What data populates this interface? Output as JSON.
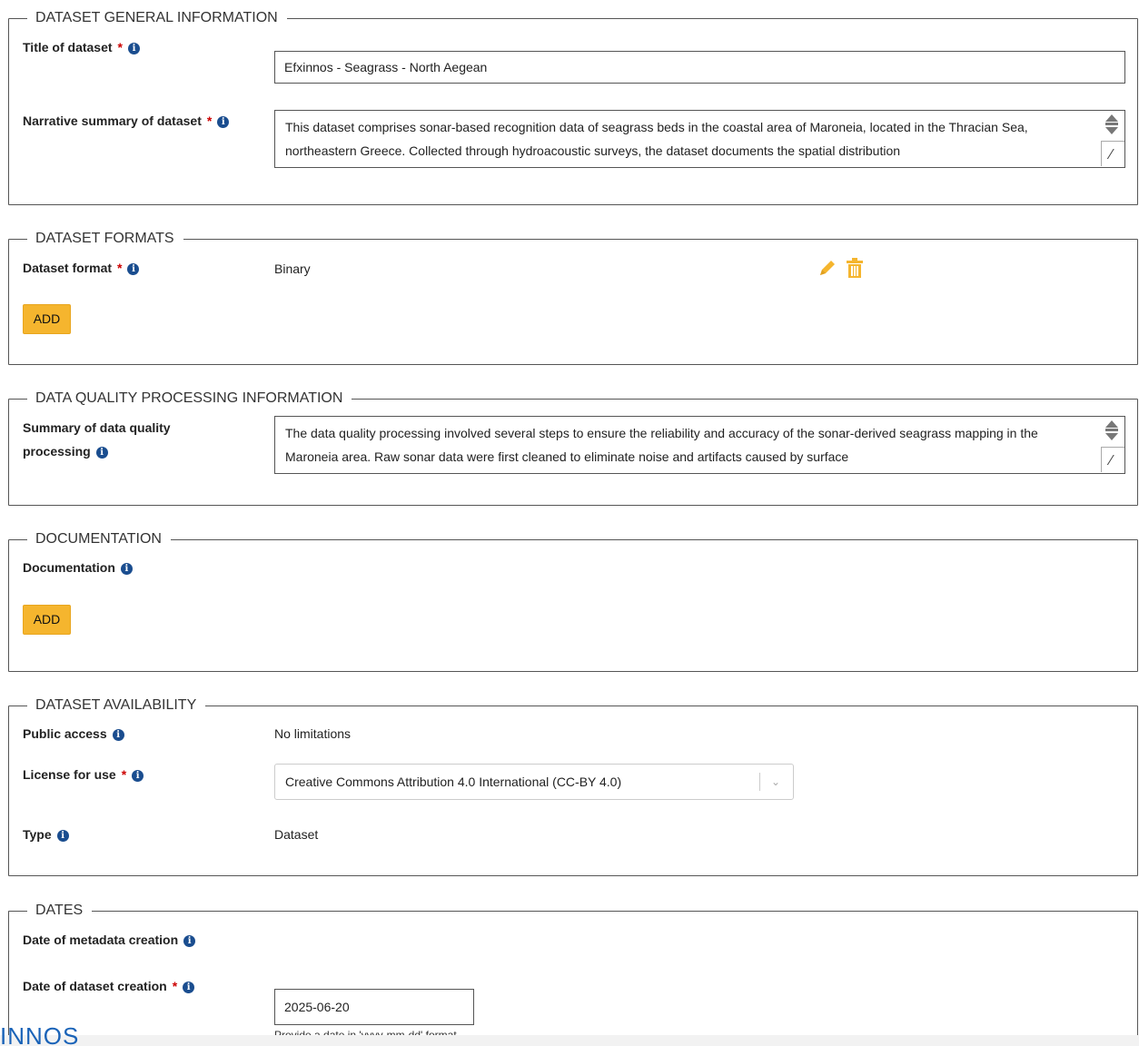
{
  "sections": {
    "general": {
      "legend": "DATASET GENERAL INFORMATION",
      "title_label": "Title of dataset",
      "title_value": "Efxinnos - Seagrass - North Aegean",
      "summary_label": "Narrative summary of dataset",
      "summary_value": "This dataset comprises sonar-based recognition data of seagrass beds in the coastal area of Maroneia, located in the Thracian Sea, northeastern Greece. Collected through hydroacoustic surveys, the dataset documents the spatial distribution"
    },
    "formats": {
      "legend": "DATASET FORMATS",
      "format_label": "Dataset format",
      "format_value": "Binary",
      "add_label": "ADD"
    },
    "quality": {
      "legend": "DATA QUALITY PROCESSING INFORMATION",
      "summary_label_line1": "Summary of data quality",
      "summary_label_line2": "processing",
      "summary_value": "The data quality processing involved several steps to ensure the reliability and accuracy of the sonar-derived seagrass mapping in the Maroneia area. Raw sonar data were first cleaned to eliminate noise and artifacts caused by surface"
    },
    "documentation": {
      "legend": "DOCUMENTATION",
      "doc_label": "Documentation",
      "add_label": "ADD"
    },
    "availability": {
      "legend": "DATASET AVAILABILITY",
      "public_label": "Public access",
      "public_value": "No limitations",
      "license_label": "License for use",
      "license_value": "Creative Commons Attribution 4.0 International (CC-BY 4.0)",
      "type_label": "Type",
      "type_value": "Dataset"
    },
    "dates": {
      "legend": "DATES",
      "metadata_label": "Date of metadata creation",
      "creation_label": "Date of dataset creation",
      "creation_value": "2025-06-20",
      "creation_hint": "Provide a date in 'yyyy-mm-dd' format"
    }
  },
  "required_marker": "*",
  "info_glyph": "i",
  "footer_text": "INNOS",
  "colors": {
    "accent": "#f5b52e",
    "info": "#1a4d8f",
    "required": "#cc0000",
    "link": "#1a63b8"
  }
}
